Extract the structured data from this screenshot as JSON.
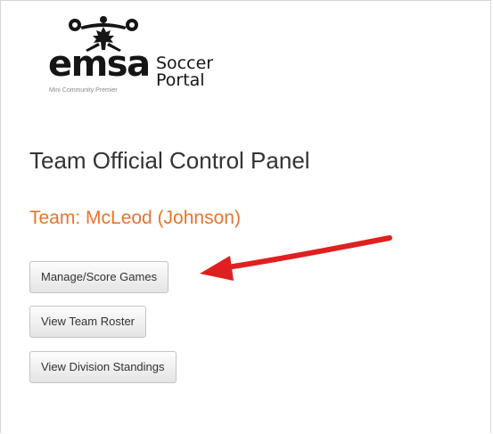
{
  "logo": {
    "brand": "emsa",
    "tagline": "Mini Community Premier",
    "product_line1": "Soccer",
    "product_line2": "Portal"
  },
  "panel": {
    "title": "Team Official Control Panel",
    "team_label": "Team: McLeod (Johnson)"
  },
  "actions": {
    "manage_score_games": "Manage/Score Games",
    "view_team_roster": "View Team Roster",
    "view_division_standings": "View Division Standings"
  },
  "colors": {
    "team_label": "#e8742a",
    "annotation_arrow": "#e02020"
  }
}
